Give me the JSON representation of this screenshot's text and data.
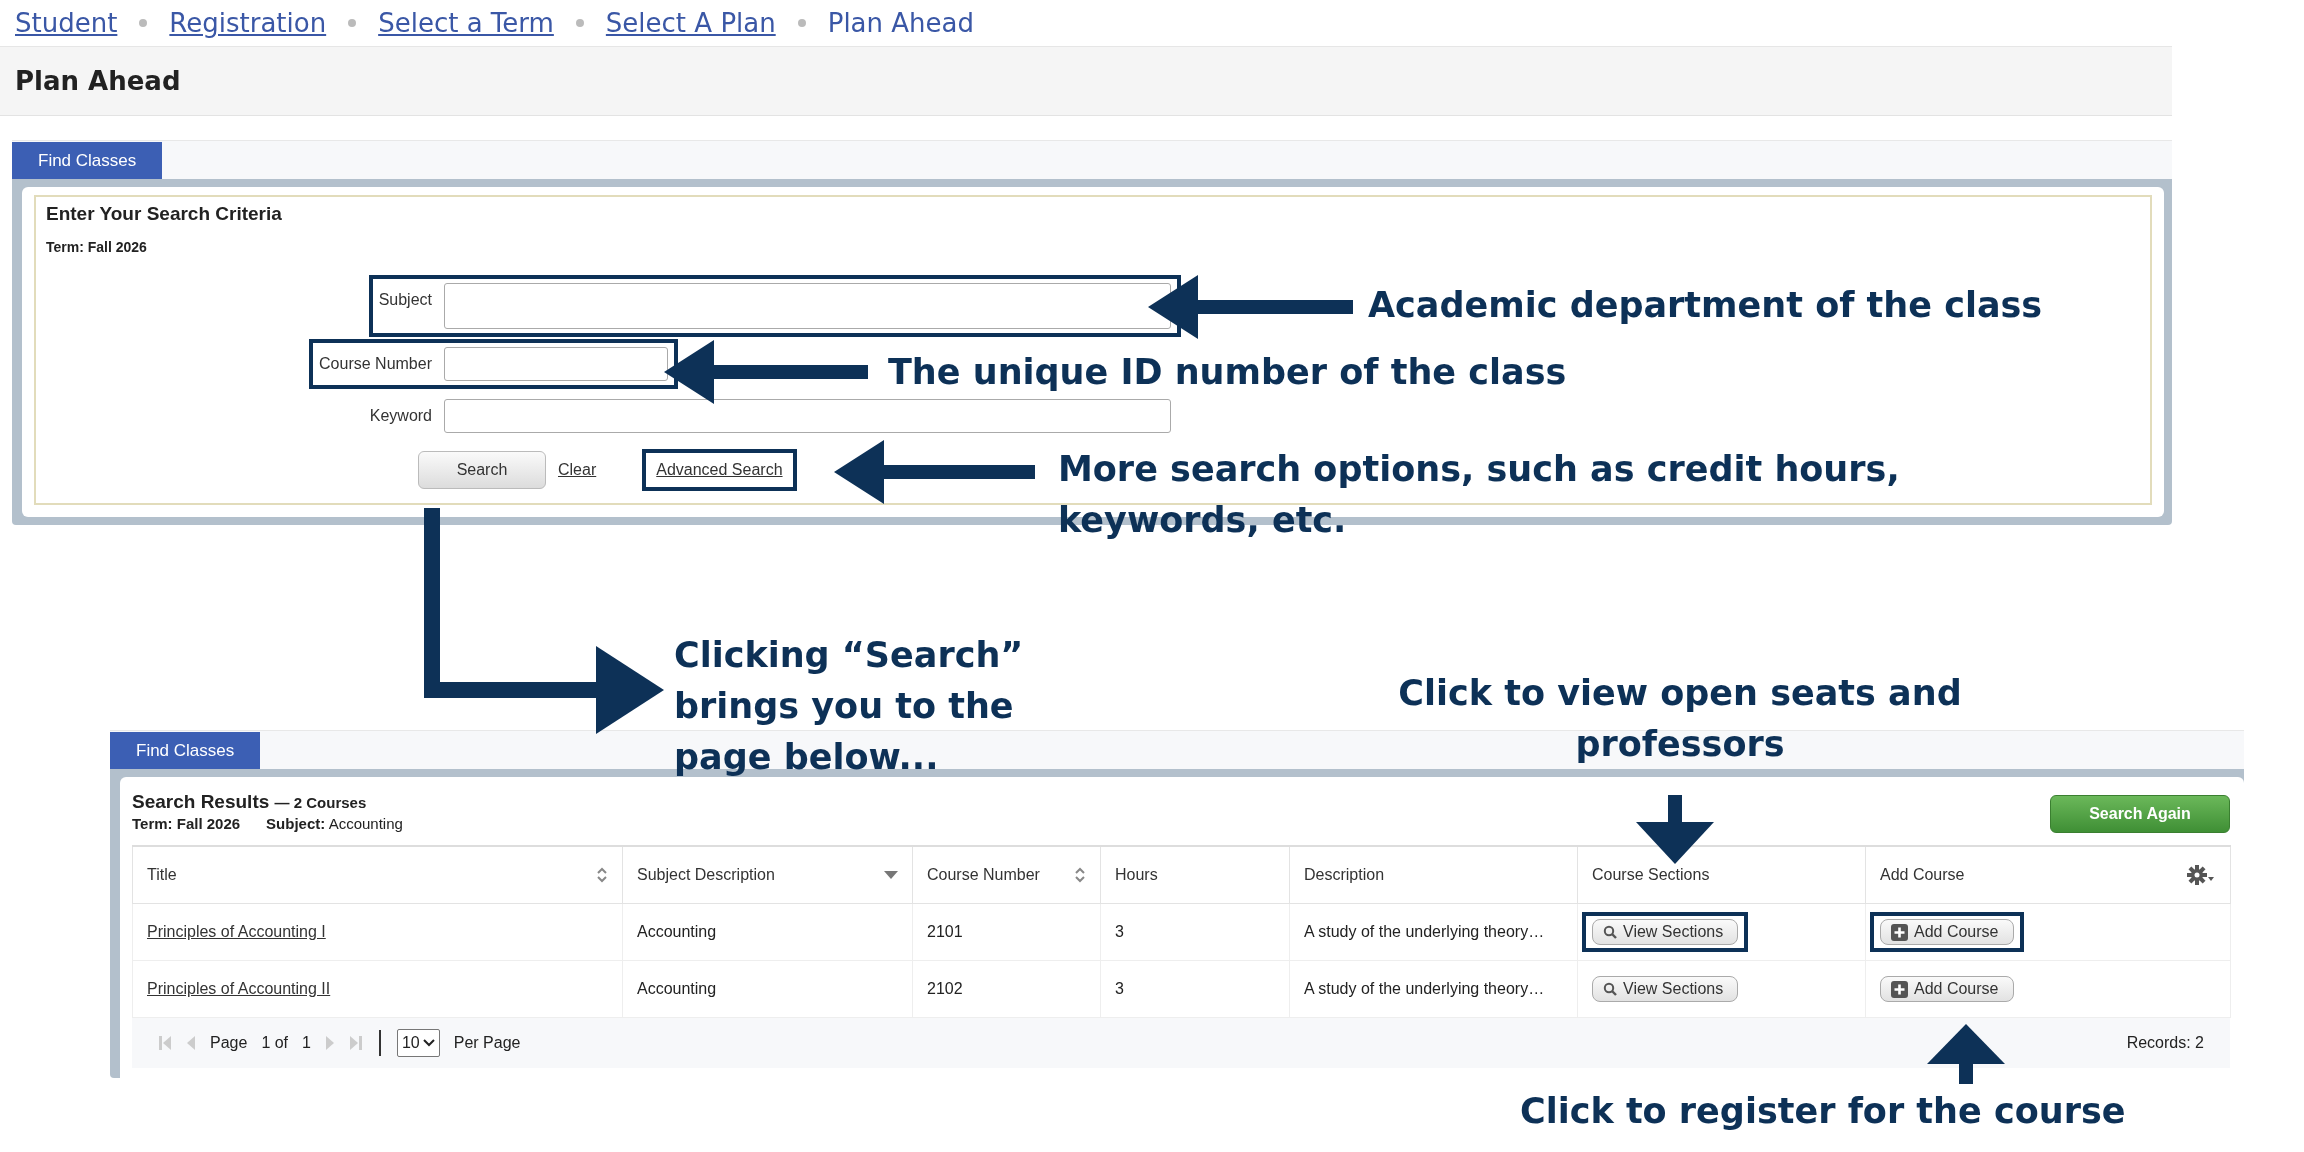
{
  "breadcrumb": [
    {
      "label": "Student",
      "link": true
    },
    {
      "label": "Registration",
      "link": true
    },
    {
      "label": "Select a Term",
      "link": true
    },
    {
      "label": "Select A Plan",
      "link": true
    },
    {
      "label": "Plan Ahead",
      "link": false
    }
  ],
  "page_title": "Plan Ahead",
  "search_panel": {
    "tab": "Find Classes",
    "heading": "Enter Your Search Criteria",
    "term": "Term: Fall 2026",
    "fields": [
      {
        "label": "Subject",
        "kind": "multi",
        "highlighted": true
      },
      {
        "label": "Course Number",
        "kind": "short",
        "highlighted": true
      },
      {
        "label": "Keyword",
        "kind": "text",
        "highlighted": false
      }
    ],
    "search_button": "Search",
    "clear_link": "Clear",
    "advanced_link": "Advanced Search",
    "advanced_highlighted": true
  },
  "results_panel": {
    "tab": "Find Classes",
    "heading": "Search Results",
    "count": "— 2 Courses",
    "term": "Term: Fall 2026",
    "subject_label": "Subject:",
    "subject": "Accounting",
    "search_again": "Search Again",
    "columns": [
      {
        "label": "Title",
        "kind": "sortable"
      },
      {
        "label": "Subject Description",
        "kind": "sorted"
      },
      {
        "label": "Course Number",
        "kind": "sortable"
      },
      {
        "label": "Hours",
        "kind": "plain"
      },
      {
        "label": "Description",
        "kind": "plain"
      },
      {
        "label": "Course Sections",
        "kind": "plain"
      },
      {
        "label": "Add Course",
        "kind": "plain"
      }
    ],
    "rows": [
      {
        "title": "Principles of Accounting I",
        "subject": "Accounting",
        "number": "2101",
        "hours": "3",
        "description": "A study of the underlying theory…",
        "sections_button": "View Sections",
        "add_button": "Add Course",
        "sections_highlighted": true,
        "add_highlighted": true
      },
      {
        "title": "Principles of Accounting II",
        "subject": "Accounting",
        "number": "2102",
        "hours": "3",
        "description": "A study of the underlying theory…",
        "sections_button": "View Sections",
        "add_button": "Add Course",
        "sections_highlighted": false,
        "add_highlighted": false
      }
    ],
    "pager": {
      "page_label": "Page",
      "page": "1 of",
      "total": "1",
      "per_page": "10",
      "per_page_label": "Per Page",
      "records": "Records: 2"
    }
  },
  "annotations": [
    "Academic department of the class",
    "The unique ID number of the class",
    "More search options, such as credit hours, keywords, etc.",
    "Clicking “Search” brings you to the page below...",
    "Click to view open seats and professors",
    "Click to register for the course"
  ]
}
